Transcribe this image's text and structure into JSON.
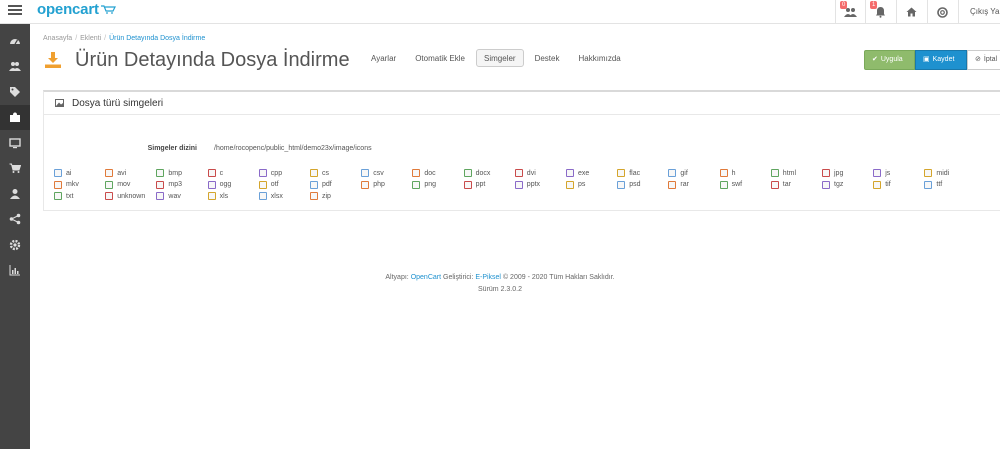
{
  "header": {
    "logo_text": "opencart",
    "badge_customers": "0",
    "badge_alerts": "1",
    "logout_label": "Çıkış Yap"
  },
  "sidebar": {
    "items": [
      {
        "icon": "dashboard-icon"
      },
      {
        "icon": "users-icon"
      },
      {
        "icon": "tags-icon"
      },
      {
        "icon": "puzzle-icon"
      },
      {
        "icon": "desktop-icon"
      },
      {
        "icon": "shopping-cart-icon"
      },
      {
        "icon": "user-icon"
      },
      {
        "icon": "share-icon"
      },
      {
        "icon": "gear-icon"
      },
      {
        "icon": "bar-chart-icon"
      }
    ]
  },
  "breadcrumb": {
    "home": "Anasayfa",
    "extensions": "Eklenti",
    "current": "Ürün Detayında Dosya İndirme"
  },
  "page": {
    "title": "Ürün Detayında Dosya İndirme",
    "tabs": [
      "Ayarlar",
      "Otomatik Ekle",
      "Simgeler",
      "Destek",
      "Hakkımızda"
    ],
    "active_tab": "Simgeler"
  },
  "actions": {
    "apply": "Uygula",
    "save": "Kaydet",
    "cancel": "İptal"
  },
  "panel": {
    "title": "Dosya türü simgeleri",
    "dir_label": "Simgeler dizini",
    "dir_value": "/home/rocopenc/public_html/demo23x/image/icons"
  },
  "file_types": [
    [
      "ai",
      "avi",
      "bmp",
      "c",
      "cpp",
      "cs",
      "csv",
      "doc",
      "docx",
      "dvi",
      "exe",
      "flac",
      "gif",
      "h",
      "html",
      "jpg",
      "js",
      "midi"
    ],
    [
      "mkv",
      "mov",
      "mp3",
      "ogg",
      "otf",
      "pdf",
      "php",
      "png",
      "ppt",
      "pptx",
      "ps",
      "psd",
      "rar",
      "swf",
      "tar",
      "tgz",
      "tif",
      "ttf"
    ],
    [
      "txt",
      "unknown",
      "wav",
      "xls",
      "xlsx",
      "zip"
    ]
  ],
  "footer": {
    "line1_prefix": "Altyapı:",
    "opencart_link": "OpenCart",
    "line1_mid": "Geliştirici:",
    "developer_link": "E-Piksel",
    "line1_suffix": "© 2009 - 2020 Tüm Hakları Saklıdır.",
    "version": "Sürüm 2.3.0.2"
  },
  "colors": {
    "brand": "#23a1d1",
    "sidebar": "#444444",
    "apply": "#8fbb6c",
    "save": "#1e91cf",
    "download_icon": "#f0a030"
  }
}
